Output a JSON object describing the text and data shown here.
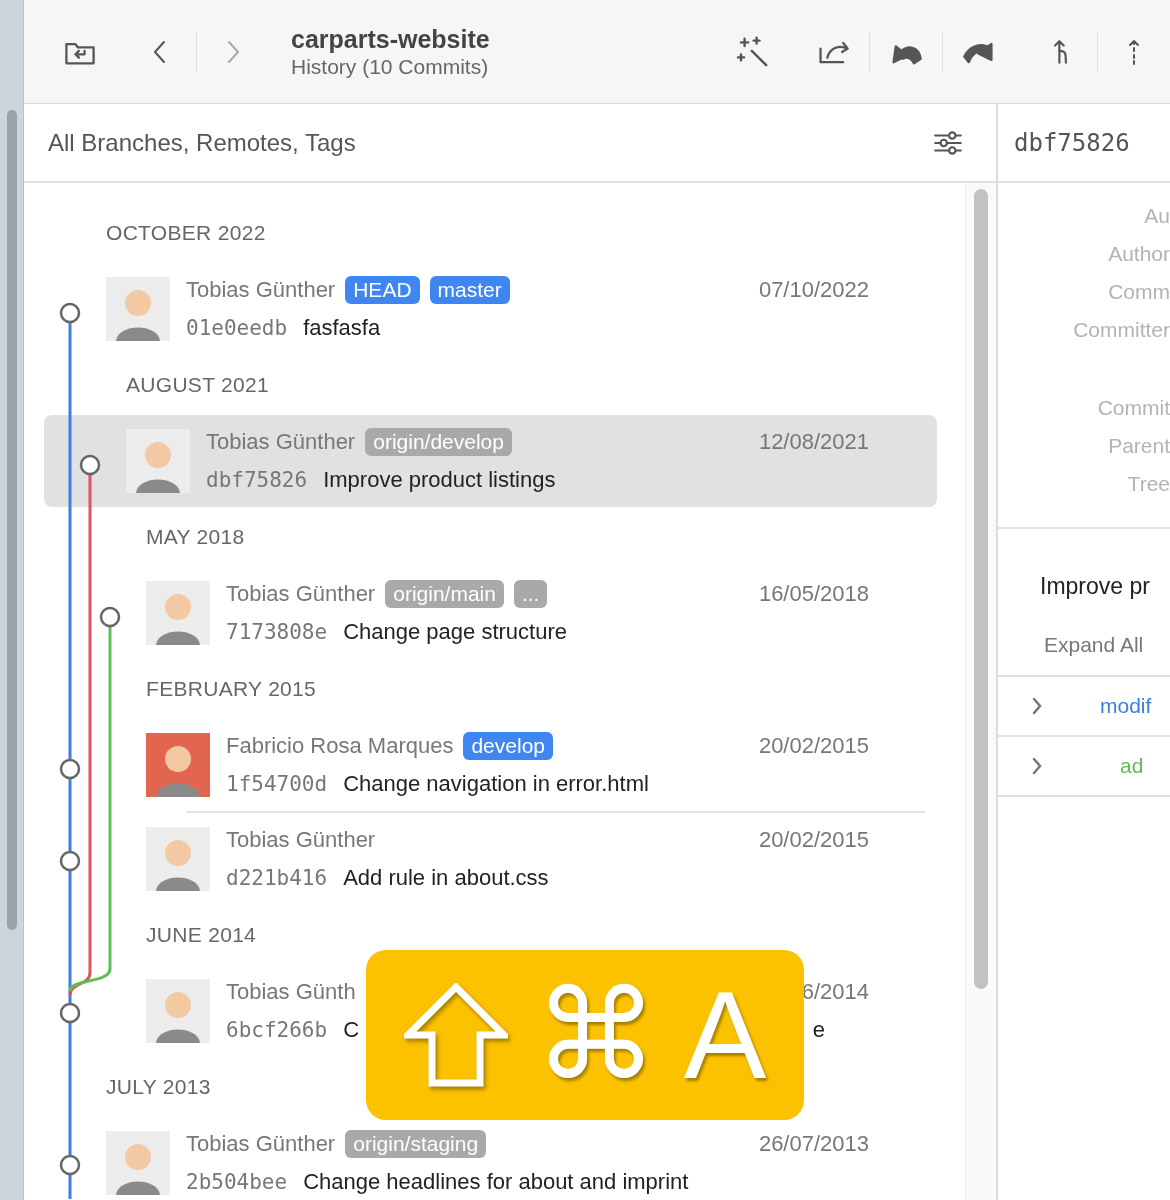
{
  "toolbar": {
    "title": "carparts-website",
    "subtitle": "History (10 Commits)",
    "back_disabled": false,
    "forward_disabled": true
  },
  "history": {
    "filter": "All Branches, Remotes, Tags",
    "groups": [
      {
        "label": "OCTOBER 2022",
        "commits": [
          {
            "author": "Tobias Günther",
            "hash": "01e0eedb",
            "subject": "fasfasfa",
            "date": "07/10/2022",
            "selected": false,
            "avatar": {
              "color": "#ececec"
            },
            "refs": [
              {
                "label": "HEAD",
                "kind": "local"
              },
              {
                "label": "master",
                "kind": "local"
              }
            ]
          }
        ]
      },
      {
        "label": "AUGUST 2021",
        "commits": [
          {
            "author": "Tobias Günther",
            "hash": "dbf75826",
            "subject": "Improve product listings",
            "date": "12/08/2021",
            "selected": true,
            "avatar": {
              "color": "#ececec"
            },
            "refs": [
              {
                "label": "origin/develop",
                "kind": "remote"
              }
            ]
          }
        ]
      },
      {
        "label": "MAY 2018",
        "commits": [
          {
            "author": "Tobias Günther",
            "hash": "7173808e",
            "subject": "Change page structure",
            "date": "16/05/2018",
            "selected": false,
            "avatar": {
              "color": "#ececec"
            },
            "refs": [
              {
                "label": "origin/main",
                "kind": "remote"
              },
              {
                "label": "...",
                "kind": "remote"
              }
            ]
          }
        ]
      },
      {
        "label": "FEBRUARY 2015",
        "commits": [
          {
            "author": "Fabricio Rosa Marques",
            "hash": "1f54700d",
            "subject": "Change navigation in error.html",
            "date": "20/02/2015",
            "selected": false,
            "avatar": {
              "color": "#e2664f"
            },
            "refs": [
              {
                "label": "develop",
                "kind": "local"
              }
            ]
          },
          {
            "author": "Tobias Günther",
            "hash": "d221b416",
            "subject": "Add rule in about.css",
            "date": "20/02/2015",
            "selected": false,
            "avatar": {
              "color": "#ececec"
            }
          }
        ]
      },
      {
        "label": "JUNE 2014",
        "commits": [
          {
            "author": "Tobias Günth",
            "hash": "6bcf266b",
            "subject": "C",
            "subject_tail": "e",
            "date": "6/2014",
            "selected": false,
            "avatar": {
              "color": "#ececec"
            }
          }
        ]
      },
      {
        "label": "JULY 2013",
        "commits": [
          {
            "author": "Tobias Günther",
            "hash": "2b504bee",
            "subject": "Change headlines for about and imprint",
            "date": "26/07/2013",
            "selected": false,
            "avatar": {
              "color": "#ececec"
            },
            "refs": [
              {
                "label": "origin/staging",
                "kind": "remote"
              }
            ]
          }
        ]
      }
    ]
  },
  "details": {
    "hash": "dbf75826",
    "fields_top": [
      "Au",
      "Author",
      "Comm",
      "Committer"
    ],
    "fields_hashes": [
      "Commit",
      "Parent",
      "Tree"
    ],
    "message": "Improve pr",
    "expand": "Expand All",
    "files": [
      {
        "label": "modif",
        "kind": "modified",
        "expanded": false
      },
      {
        "label": "ad",
        "kind": "added",
        "expanded": false
      }
    ]
  },
  "shortcut": {
    "keys": [
      {
        "kind": "shift"
      },
      {
        "kind": "glyph",
        "label": "⌘"
      },
      {
        "kind": "glyph",
        "label": "A"
      }
    ]
  }
}
